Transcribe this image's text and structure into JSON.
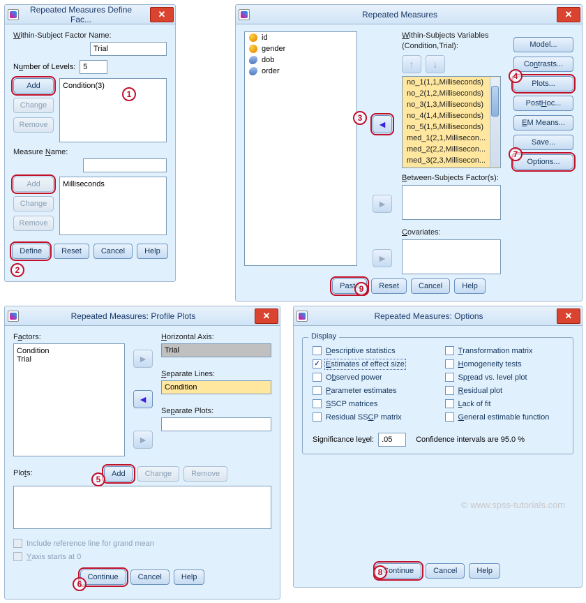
{
  "dlg1": {
    "title": "Repeated Measures Define Fac...",
    "factor_label": "Within-Subject Factor Name:",
    "factor_value": "Trial",
    "levels_label": "Number of Levels:",
    "levels_value": "5",
    "add": "Add",
    "change": "Change",
    "remove": "Remove",
    "list1_item": "Condition(3)",
    "measure_label": "Measure Name:",
    "list2_item": "Milliseconds",
    "define": "Define",
    "reset": "Reset",
    "cancel": "Cancel",
    "help": "Help"
  },
  "dlg2": {
    "title": "Repeated Measures",
    "vars": [
      "id",
      "gender",
      "dob",
      "order"
    ],
    "ws_label": "Within-Subjects Variables",
    "ws_sub": "(Condition,Trial):",
    "ws_items": [
      "no_1(1,1,Milliseconds)",
      "no_2(1,2,Milliseconds)",
      "no_3(1,3,Milliseconds)",
      "no_4(1,4,Milliseconds)",
      "no_5(1,5,Milliseconds)",
      "med_1(2,1,Millisecon...",
      "med_2(2,2,Millisecon...",
      "med_3(2,3,Millisecon..."
    ],
    "between_label": "Between-Subjects Factor(s):",
    "cov_label": "Covariates:",
    "buttons": {
      "model": "Model...",
      "contrasts": "Contrasts...",
      "plots": "Plots...",
      "posthoc": "Post Hoc...",
      "emmeans": "EM Means...",
      "save": "Save...",
      "options": "Options..."
    },
    "paste": "Paste",
    "reset": "Reset",
    "cancel": "Cancel",
    "help": "Help"
  },
  "dlg3": {
    "title": "Repeated Measures: Profile Plots",
    "factors_label": "Factors:",
    "factors": [
      "Condition",
      "Trial"
    ],
    "haxis_label": "Horizontal Axis:",
    "haxis_value": "Trial",
    "seplines_label": "Separate Lines:",
    "seplines_value": "Condition",
    "sepplots_label": "Separate Plots:",
    "plots_label": "Plots:",
    "add": "Add",
    "change": "Change",
    "remove": "Remove",
    "chk1": "Include reference line for grand mean",
    "chk2": "Y axis starts at 0",
    "continue": "Continue",
    "cancel": "Cancel",
    "help": "Help"
  },
  "dlg4": {
    "title": "Repeated Measures: Options",
    "group": "Display",
    "left": [
      "Descriptive statistics",
      "Estimates of effect size",
      "Observed power",
      "Parameter estimates",
      "SSCP matrices",
      "Residual SSCP matrix"
    ],
    "right": [
      "Transformation matrix",
      "Homogeneity tests",
      "Spread vs. level plot",
      "Residual plot",
      "Lack of fit",
      "General estimable function"
    ],
    "sig_label": "Significance level:",
    "sig_value": ".05",
    "conf_text": "Confidence intervals are 95.0 %",
    "continue": "Continue",
    "cancel": "Cancel",
    "help": "Help"
  },
  "callouts": {
    "1": "1",
    "2": "2",
    "3": "3",
    "4": "4",
    "5": "5",
    "6": "6",
    "7": "7",
    "8": "8",
    "9": "9"
  },
  "watermark": "© www.spss-tutorials.com"
}
